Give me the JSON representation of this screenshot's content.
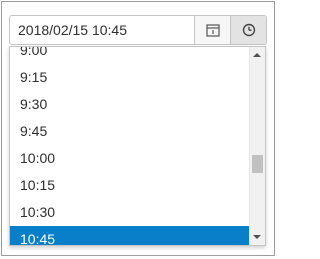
{
  "datetime_picker": {
    "value": "2018/02/15 10:45",
    "calendar_icon": "calendar-icon",
    "clock_icon": "clock-icon"
  },
  "time_list": {
    "items": [
      "9:00",
      "9:15",
      "9:30",
      "9:45",
      "10:00",
      "10:15",
      "10:30",
      "10:45"
    ],
    "selected": "10:45",
    "scroll_position_fraction": 0.62
  },
  "colors": {
    "selected_bg": "#0a7fc9",
    "selected_text": "#ffffff",
    "text": "#2e2e2e",
    "border": "#c5c5c5"
  }
}
